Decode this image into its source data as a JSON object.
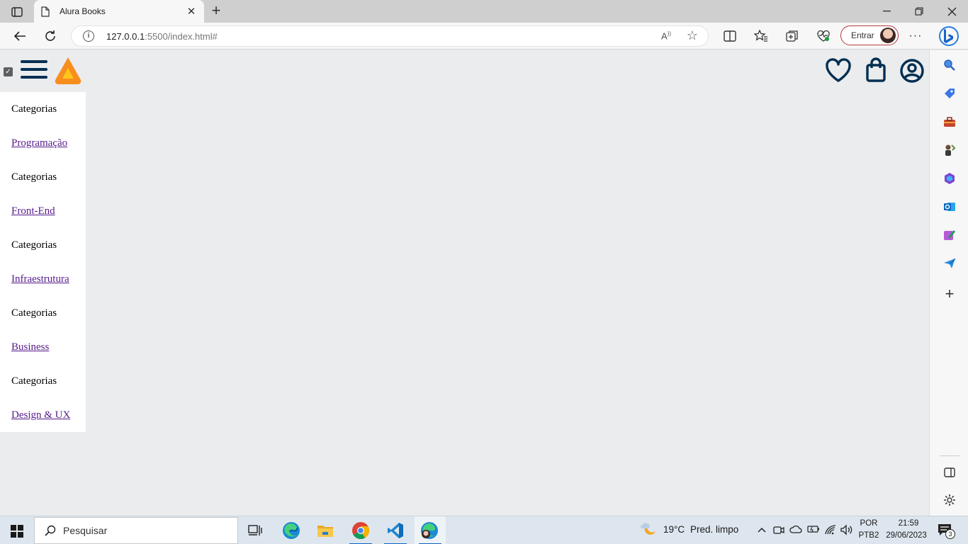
{
  "browser": {
    "tab_title": "Alura Books",
    "address_url_host": "127.0.0.1",
    "address_url_rest": ":5500/index.html#",
    "read_aloud_label": "A",
    "signin_label": "Entrar",
    "more_label": "···"
  },
  "page": {
    "menu_items": [
      {
        "label": "Categorias",
        "type": "text"
      },
      {
        "label": "Programação",
        "type": "link"
      },
      {
        "label": "Categorias",
        "type": "text"
      },
      {
        "label": "Front-End",
        "type": "link"
      },
      {
        "label": "Categorias",
        "type": "text"
      },
      {
        "label": "Infraestrutura",
        "type": "link"
      },
      {
        "label": "Categorias",
        "type": "text"
      },
      {
        "label": "Business",
        "type": "link"
      },
      {
        "label": "Categorias",
        "type": "text"
      },
      {
        "label": "Design & UX",
        "type": "link"
      }
    ],
    "header_icons": [
      "favorites-heart-icon",
      "shopping-bag-icon",
      "user-account-icon"
    ],
    "colors": {
      "brand_dark": "#002f52",
      "logo_orange": "#f78e1e"
    }
  },
  "sidebar": {
    "icons": [
      "search-icon",
      "shopping-tag-icon",
      "tools-icon",
      "games-icon",
      "office-icon",
      "outlook-icon",
      "designer-icon",
      "send-icon",
      "add-icon",
      "split-screen-icon",
      "settings-icon"
    ]
  },
  "taskbar": {
    "search_placeholder": "Pesquisar",
    "weather_temp": "19°C",
    "weather_desc": "Pred. limpo",
    "lang_top": "POR",
    "lang_bottom": "PTB2",
    "time": "21:59",
    "date": "29/06/2023",
    "notification_count": "3",
    "apps": [
      "task-view-icon",
      "edge-icon",
      "file-explorer-icon",
      "chrome-icon",
      "vscode-icon",
      "edge-profile-icon"
    ]
  }
}
